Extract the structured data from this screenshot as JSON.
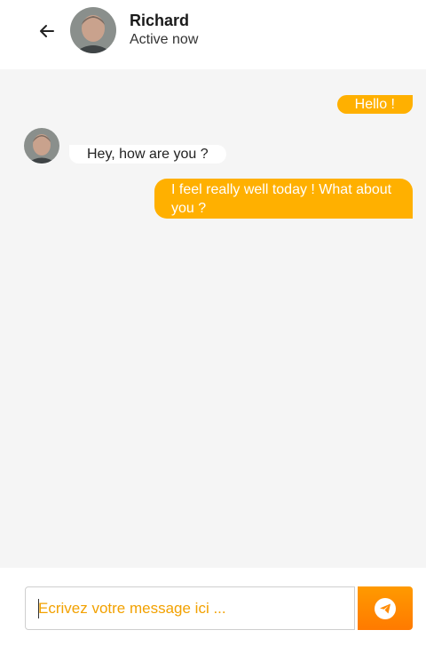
{
  "header": {
    "back_icon": "arrow-left-icon",
    "contact_name": "Richard",
    "contact_status": "Active now"
  },
  "messages": [
    {
      "direction": "outgoing",
      "text": "Hello !"
    },
    {
      "direction": "incoming",
      "text": "Hey, how are you ?"
    },
    {
      "direction": "outgoing",
      "text": "I feel really well today ! What about you ?"
    }
  ],
  "composer": {
    "placeholder": "Ecrivez votre message ici ...",
    "send_icon": "paper-plane-icon"
  },
  "colors": {
    "accent": "#ffb000",
    "send_button": "#ff8a00",
    "chat_background": "#f5f5f5"
  }
}
